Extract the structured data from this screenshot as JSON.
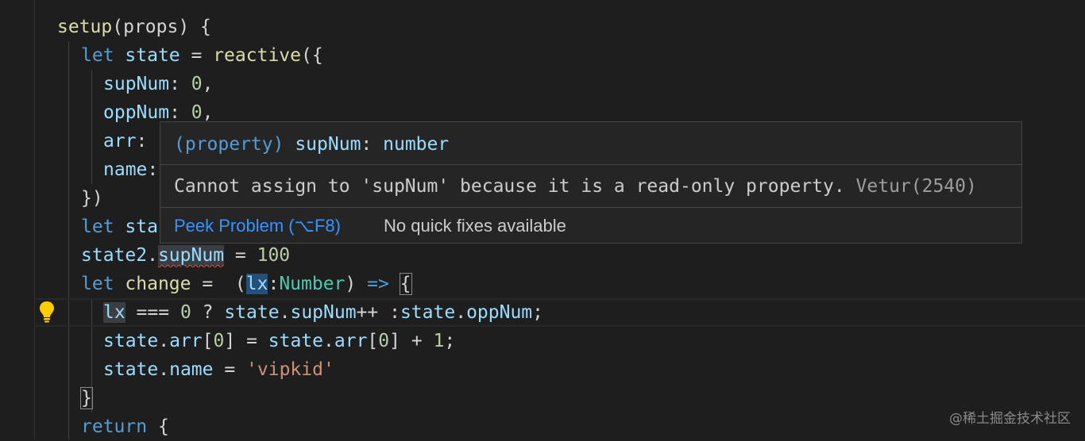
{
  "code": {
    "l1": {
      "a": "setup",
      "b": "(props) {"
    },
    "l2": {
      "kw": "let",
      "v": "state",
      "eq": " = ",
      "f": "reactive",
      "p": "({"
    },
    "l3": {
      "k": "supNum",
      "c": ": ",
      "n": "0",
      "t": ","
    },
    "l4": {
      "k": "oppNum",
      "c": ": ",
      "n": "0",
      "t": ","
    },
    "l5": {
      "k": "arr",
      "c": ": "
    },
    "l6": {
      "k": "name",
      "c": ":"
    },
    "l7": {
      "t": "})"
    },
    "l8": {
      "kw": "let",
      "v": "sta"
    },
    "l9": {
      "v": "state2",
      "d": ".",
      "prop": "supNum",
      "eq": " = ",
      "n": "100"
    },
    "l10": {
      "kw": "let",
      "v": "change",
      "eq": " =  (",
      "p": "lx",
      "c": ":",
      "ty": "Number",
      "cl": ") ",
      "arr": "=>",
      "sp": " ",
      "br": "{"
    },
    "l11": {
      "p": "lx",
      "op": " === ",
      "n": "0",
      "q": " ? ",
      "s1": "state",
      "d1": ".",
      "f1": "supNum",
      "inc": "++ :",
      "s2": "state",
      "d2": ".",
      "f2": "oppNum",
      "end": ";"
    },
    "l12": {
      "s1": "state",
      "d1": ".",
      "f1": "arr",
      "i1": "[",
      "n1": "0",
      "i2": "] = ",
      "s2": "state",
      "d2": ".",
      "f2": "arr",
      "i3": "[",
      "n2": "0",
      "i4": "] + ",
      "n3": "1",
      "end": ";"
    },
    "l13": {
      "s": "state",
      "d": ".",
      "f": "name",
      "eq": " = ",
      "str": "'vipkid'"
    },
    "l14": {
      "br": "}"
    },
    "l15": {
      "kw": "return",
      "t": " {"
    }
  },
  "hover": {
    "sig_prefix": "(property) ",
    "sig_name": "supNum",
    "sig_colon": ": ",
    "sig_type": "number",
    "message": "Cannot assign to 'supNum' because it is a read-only property. ",
    "source": "Vetur(2540)",
    "peek_label": "Peek Problem (⌥F8)",
    "no_fix_label": "No quick fixes available"
  },
  "watermark": "@稀土掘金技术社区",
  "colors": {
    "background": "#1e1e1e",
    "keyword": "#569cd6",
    "function": "#dcdcaa",
    "variable": "#9cdcfe",
    "number": "#b5cea8",
    "string": "#ce9178",
    "type": "#4ec9b0",
    "link": "#3794ff",
    "error": "#f14c4c"
  },
  "icons": {
    "gutter": "lightbulb-icon"
  }
}
